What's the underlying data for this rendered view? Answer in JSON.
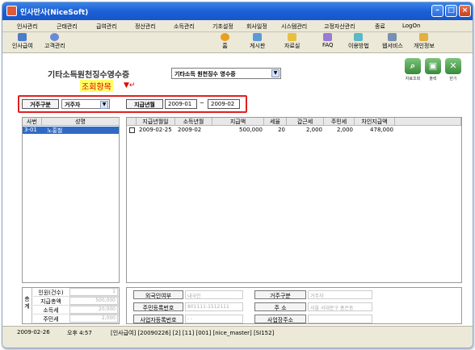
{
  "window": {
    "title": "인사만사(NiceSoft)"
  },
  "menu": [
    "인사관리",
    "근태관리",
    "급여관리",
    "정산관리",
    "소득관리",
    "기초설정",
    "회사일정",
    "시스템관리",
    "고정자산관리",
    "종료",
    "LogOn"
  ],
  "toolbar_left": [
    "인사급여",
    "고객관리"
  ],
  "toolbar_right": [
    "홈",
    "게시판",
    "자료실",
    "FAQ",
    "이용방법",
    "웹서비스",
    "개인정보"
  ],
  "page": {
    "heading": "기타소득원천징수영수증",
    "form_select": "기타소득 원천징수 영수증",
    "buttons": [
      "자료조회",
      "출력",
      "닫기"
    ],
    "annotation": "조회항목"
  },
  "criteria": {
    "resident_label": "거주구분",
    "resident_value": "거주자",
    "period_label": "지급년월",
    "period_from": "2009-01",
    "period_sep": "~",
    "period_to": "2009-02"
  },
  "left_list": {
    "headers": [
      "사번",
      "성명"
    ],
    "rows": [
      {
        "id": "3-01",
        "name": "노홍철"
      }
    ]
  },
  "grid": {
    "headers": [
      "지급년월일",
      "소득년월",
      "지급액",
      "세율",
      "갑근세",
      "주민세",
      "차인지급액"
    ],
    "rows": [
      {
        "pay_date": "2009-02-25",
        "income_month": "2009-02",
        "amount": "500,000",
        "rate": "20",
        "income_tax": "2,000",
        "resident_tax": "2,000",
        "net": "478,000"
      }
    ]
  },
  "totals": {
    "side_label": "총계",
    "rows": [
      {
        "label": "인원(건수)",
        "value": "1"
      },
      {
        "label": "지급총액",
        "value": "500,000"
      },
      {
        "label": "소득세",
        "value": "20,000"
      },
      {
        "label": "주민세",
        "value": "2,000"
      }
    ]
  },
  "info": {
    "foreigner_label": "외국인여부",
    "foreigner_value": "내국인",
    "resident_type_label": "거주구분",
    "resident_type_value": "거주자",
    "rrn_label": "주민등록번호",
    "rrn_value": "801111-1512111",
    "address_label": "주 소",
    "address_value": "서울 서대문구 홍은동",
    "bizno_label": "사업자등록번호",
    "bizno_value": "- -",
    "bizaddr_label": "사업장주소",
    "bizaddr_value": ""
  },
  "status": {
    "date": "2009-02-26",
    "time": "오후 4:57",
    "info": "[인사급여] [20090226] [2] [11] [001] [nice_master] [SI152]"
  },
  "colors": {
    "accent": "#1c5fd6",
    "highlight": "#316ac5",
    "annotation_border": "#e02020"
  }
}
